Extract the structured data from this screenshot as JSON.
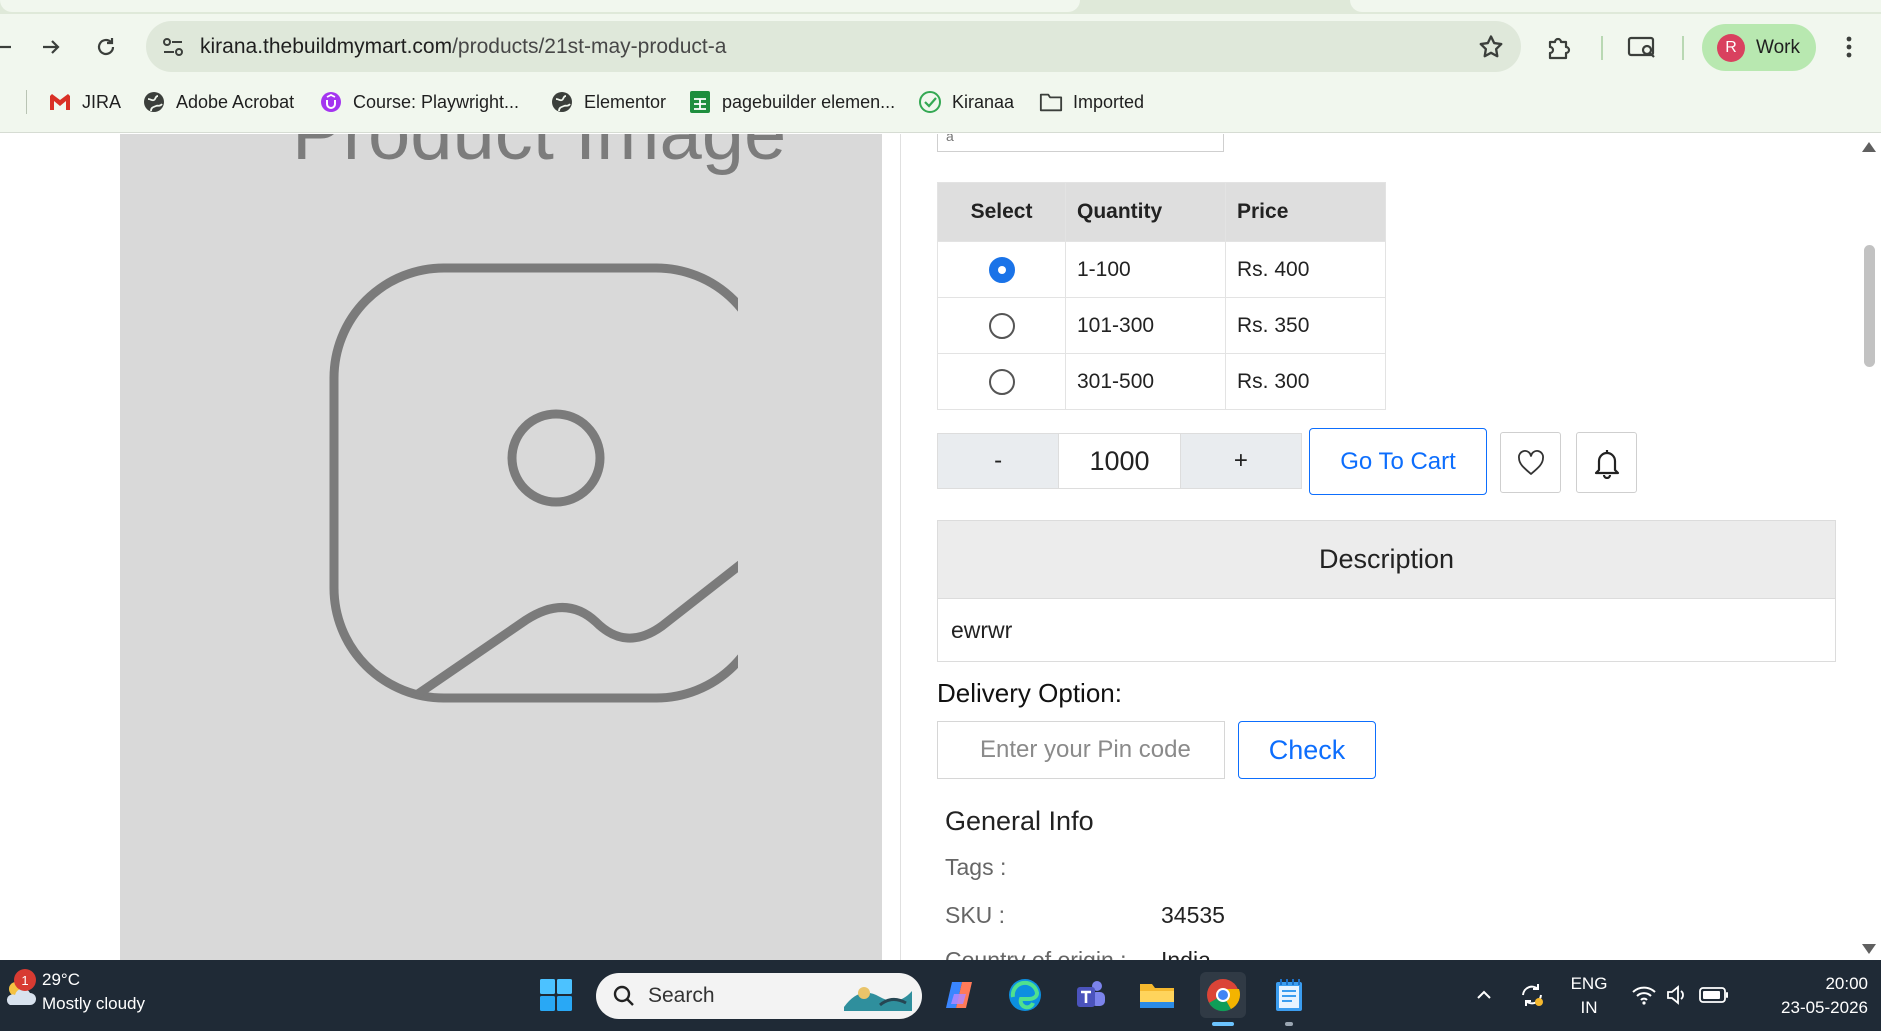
{
  "browser": {
    "url_host": "kirana.thebuildmymart.com",
    "url_path": "/products/21st-may-product-a",
    "profile_initial": "R",
    "profile_label": "Work",
    "bookmarks": [
      {
        "label": "JIRA",
        "icon": "gmail-icon"
      },
      {
        "label": "Adobe Acrobat",
        "icon": "globe-icon"
      },
      {
        "label": "Course: Playwright...",
        "icon": "udemy-icon"
      },
      {
        "label": "Elementor",
        "icon": "globe-icon"
      },
      {
        "label": "pagebuilder elemen...",
        "icon": "sheets-icon"
      },
      {
        "label": "Kiranaa",
        "icon": "check-circle-icon"
      },
      {
        "label": "Imported",
        "icon": "folder-icon"
      }
    ]
  },
  "product": {
    "image_placeholder_text": "Product Image",
    "price_table": {
      "headers": [
        "Select",
        "Quantity",
        "Price"
      ],
      "rows": [
        {
          "quantity": "1-100",
          "price": "Rs. 400",
          "selected": true
        },
        {
          "quantity": "101-300",
          "price": "Rs. 350",
          "selected": false
        },
        {
          "quantity": "301-500",
          "price": "Rs. 300",
          "selected": false
        }
      ]
    },
    "qty": {
      "minus": "-",
      "value": "1000",
      "plus": "+"
    },
    "go_to_cart": "Go To Cart",
    "description": {
      "title": "Description",
      "body": "ewrwr"
    },
    "delivery": {
      "title": "Delivery Option:",
      "placeholder": "Enter your Pin code",
      "check_label": "Check"
    },
    "general_info": {
      "title": "General Info",
      "tags_label": "Tags :",
      "sku_label": "SKU :",
      "sku_value": "34535",
      "origin_label": "Country of origin :",
      "origin_value": "India"
    }
  },
  "taskbar": {
    "temperature": "29°C",
    "weather": "Mostly cloudy",
    "weather_badge": "1",
    "search_label": "Search",
    "lang_line1": "ENG",
    "lang_line2": "IN",
    "time": "20:00",
    "date": "23-05-2026"
  },
  "colors": {
    "accent": "#0d6efd",
    "radio": "#1a73e8",
    "chrome_bg": "#f1f7ee",
    "taskbar": "#1f2a36"
  }
}
